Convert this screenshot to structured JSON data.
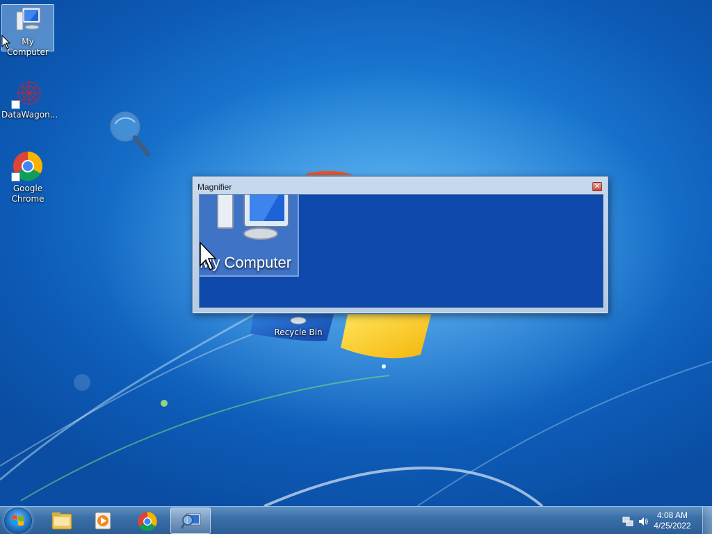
{
  "desktop": {
    "icons": [
      {
        "label": "My Computer",
        "icon": "computer-icon",
        "selected": true
      },
      {
        "label": "DataWagon...",
        "icon": "datawagon-icon",
        "shortcut": true
      },
      {
        "label": "Google Chrome",
        "icon": "chrome-icon",
        "shortcut": true
      },
      {
        "label": "Recycle Bin",
        "icon": "recycle-bin-icon"
      }
    ]
  },
  "magnifier": {
    "title": "Magnifier",
    "close_glyph": "✕",
    "magnified_label": "My Computer"
  },
  "taskbar": {
    "buttons": [
      {
        "name": "start-button",
        "icon": "windows-logo-icon"
      },
      {
        "name": "explorer",
        "icon": "folder-icon"
      },
      {
        "name": "media-player",
        "icon": "media-player-icon"
      },
      {
        "name": "chrome",
        "icon": "chrome-icon"
      },
      {
        "name": "magnifier",
        "icon": "magnifier-icon",
        "active": true
      }
    ],
    "clock": {
      "time": "4:08 AM",
      "date": "4/25/2022"
    },
    "tray_icons": [
      "network-icon",
      "volume-icon"
    ]
  },
  "colors": {
    "desktop_blue": "#1976cf",
    "taskbar": "#3a6fa8",
    "magnifier_view": "#0e49ab"
  }
}
